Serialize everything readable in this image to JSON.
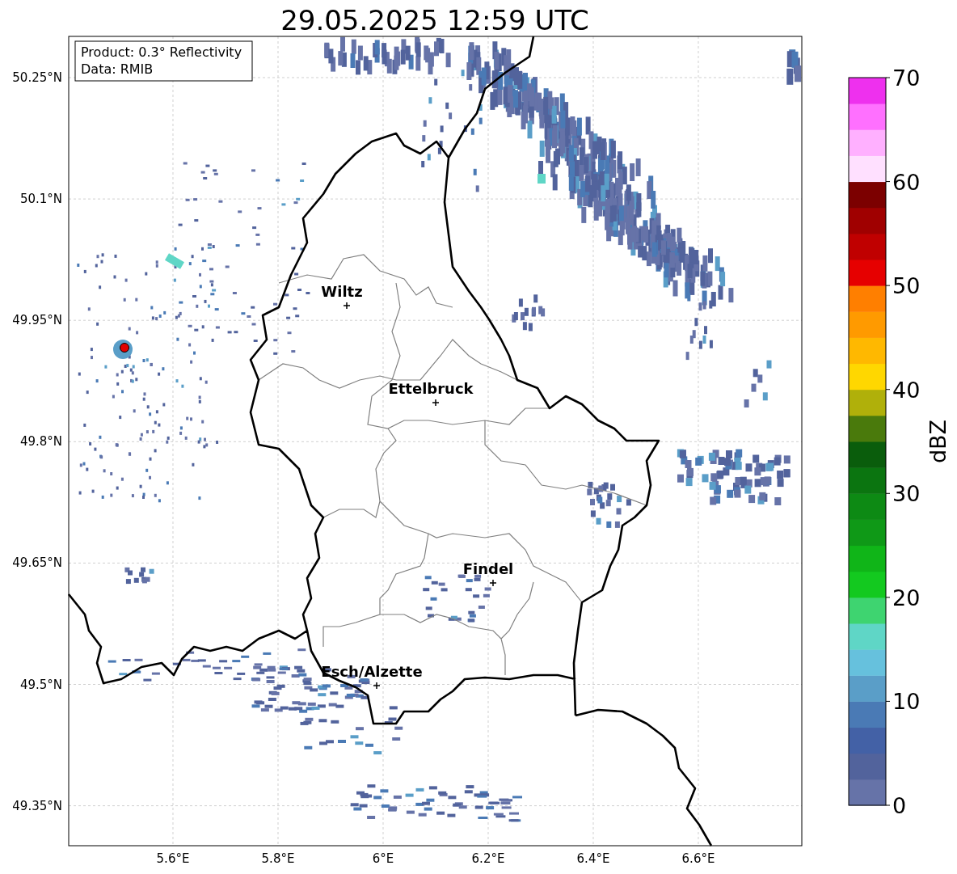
{
  "title": "29.05.2025 12:59 UTC",
  "info_box": [
    "Product: 0.3° Reflectivity",
    "Data: RMIB"
  ],
  "lat_labels": [
    "50.25°N",
    "50.1°N",
    "49.95°N",
    "49.8°N",
    "49.65°N",
    "49.5°N",
    "49.35°N"
  ],
  "lon_labels": [
    "5.6°E",
    "5.8°E",
    "6°E",
    "6.2°E",
    "6.4°E",
    "6.6°E"
  ],
  "cities": [
    {
      "name": "Wiltz"
    },
    {
      "name": "Ettelbruck"
    },
    {
      "name": "Findel"
    },
    {
      "name": "Esch/Alzette"
    }
  ],
  "colorbar": {
    "label": "dBZ",
    "ticks": [
      "70",
      "60",
      "50",
      "40",
      "30",
      "20",
      "10",
      "0"
    ]
  }
}
